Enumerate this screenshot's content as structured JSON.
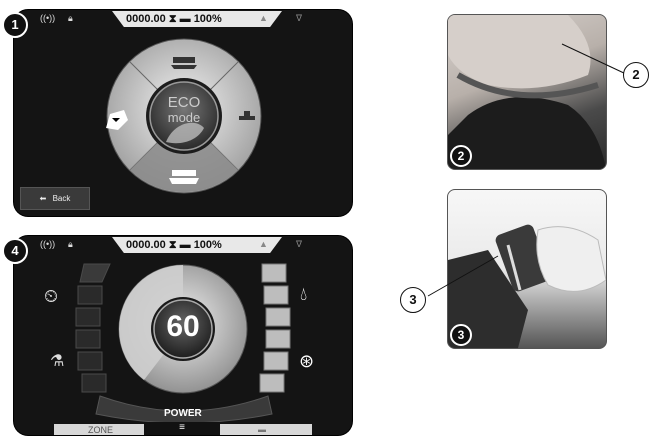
{
  "screen1": {
    "badge": "1",
    "status": {
      "counter": "0000.00",
      "battery": "100%"
    },
    "center": {
      "line1": "ECO",
      "line2": "mode"
    },
    "back_label": "Back"
  },
  "screen4": {
    "badge": "4",
    "status": {
      "counter": "0000.00",
      "battery": "100%"
    },
    "speed_value": "60",
    "power_label": "POWER",
    "tabs": {
      "zone": "ZONE"
    }
  },
  "photo2": {
    "badge": "2",
    "callout": "2"
  },
  "photo3": {
    "badge": "3",
    "callout": "3"
  },
  "colors": {
    "screen_bg": "#141414",
    "accent": "#e8e8e8"
  }
}
